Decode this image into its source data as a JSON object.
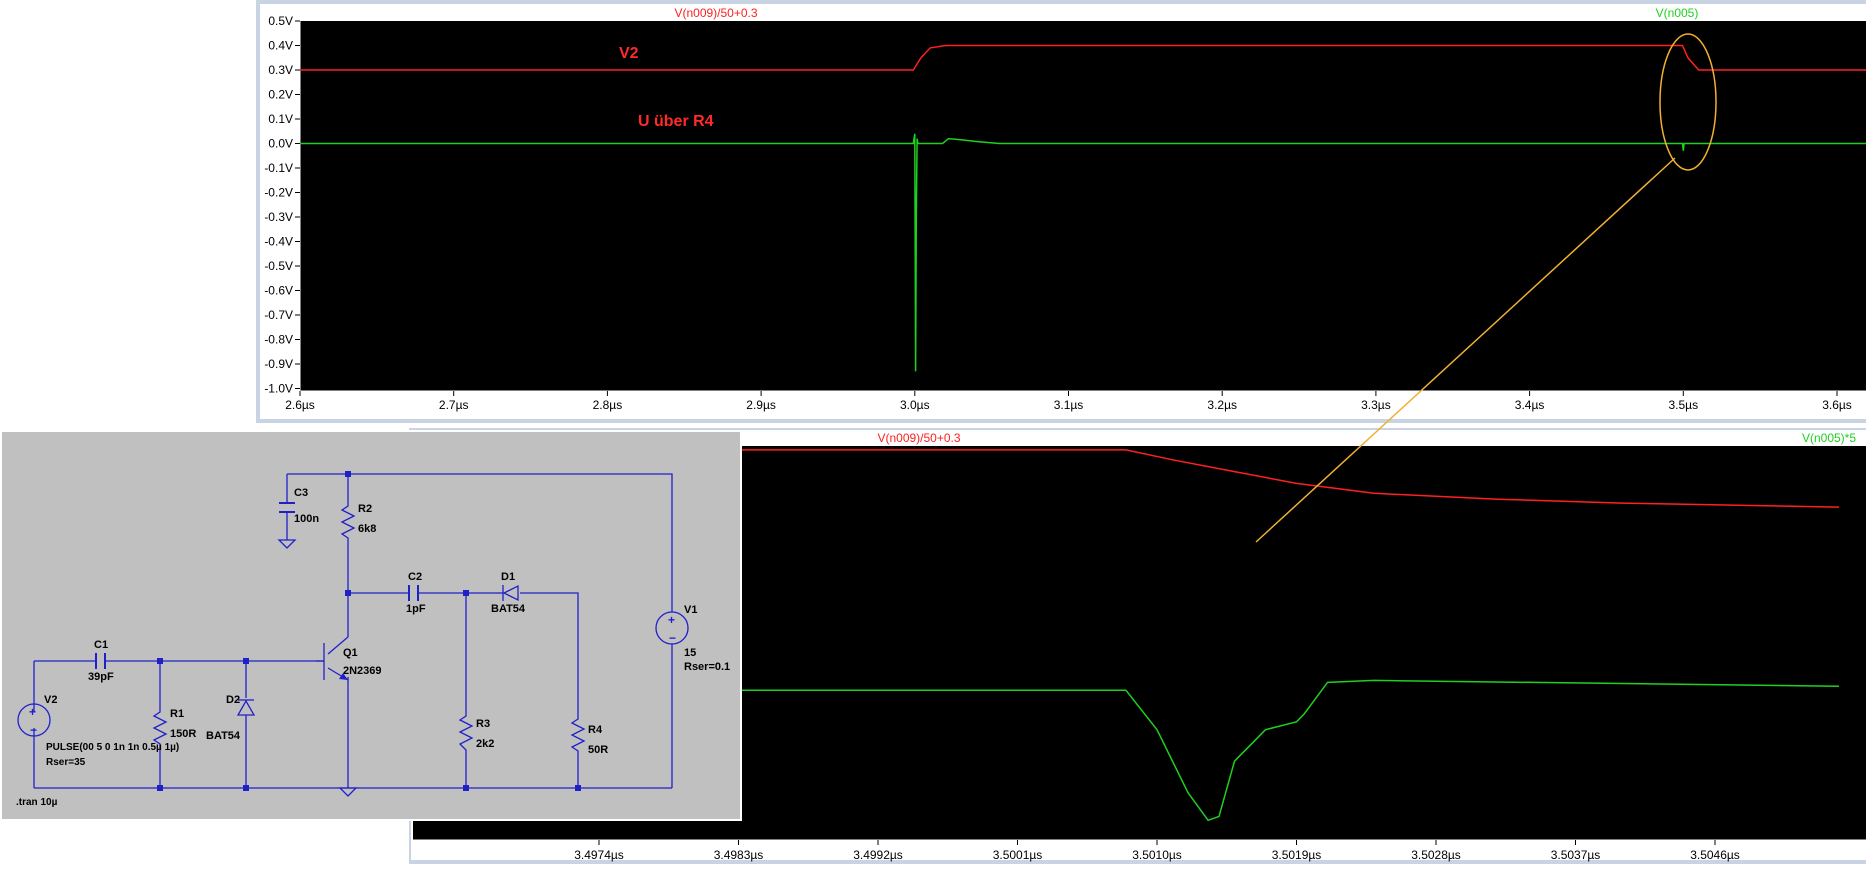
{
  "colors": {
    "trace_red": "#ff2020",
    "trace_green": "#1fd01f",
    "annotation": "#f0b030",
    "label_red": "#ff2a2a",
    "schematic_wire": "#2020c8",
    "schematic_bg": "#c0c0c0",
    "plot_bg": "#000000",
    "frame": "#c8d4e4"
  },
  "chart_data": [
    {
      "type": "line",
      "series": [
        {
          "name": "V(n009)/50+0.3",
          "color": "#ff2020",
          "x": [
            2.6,
            2.999,
            3.004,
            3.01,
            3.02,
            3.4995,
            3.503,
            3.51,
            3.62
          ],
          "y": [
            0.3,
            0.3,
            0.35,
            0.39,
            0.4,
            0.4,
            0.35,
            0.3,
            0.3
          ]
        },
        {
          "name": "V(n005)",
          "color": "#1fd01f",
          "x": [
            2.6,
            2.999,
            3.0,
            3.0005,
            3.001,
            3.0015,
            3.002,
            3.005,
            3.018,
            3.022,
            3.03,
            3.04,
            3.055,
            3.2,
            3.4995,
            3.5,
            3.5005,
            3.501,
            3.62
          ],
          "y": [
            0.0,
            0.0,
            0.04,
            -0.93,
            -0.3,
            0.02,
            0.0,
            0.0,
            0.0,
            0.02,
            0.015,
            0.008,
            0.0,
            0.0,
            0.0,
            -0.03,
            0.0,
            0.0,
            0.0
          ]
        }
      ],
      "xlabel": "",
      "ylabel": "",
      "xlim": [
        2.6,
        3.62
      ],
      "ylim": [
        -1.0,
        0.5
      ],
      "xticks": [
        2.6,
        2.7,
        2.8,
        2.9,
        3.0,
        3.1,
        3.2,
        3.3,
        3.4,
        3.5,
        3.6
      ],
      "xtick_labels": [
        "2.6µs",
        "2.7µs",
        "2.8µs",
        "2.9µs",
        "3.0µs",
        "3.1µs",
        "3.2µs",
        "3.3µs",
        "3.4µs",
        "3.5µs",
        "3.6µs"
      ],
      "yticks": [
        0.5,
        0.4,
        0.3,
        0.2,
        0.1,
        0.0,
        -0.1,
        -0.2,
        -0.3,
        -0.4,
        -0.5,
        -0.6,
        -0.7,
        -0.8,
        -0.9,
        -1.0
      ],
      "ytick_labels": [
        "0.5V",
        "0.4V",
        "0.3V",
        "0.2V",
        "0.1V",
        "0.0V",
        "-0.1V",
        "-0.2V",
        "-0.3V",
        "-0.4V",
        "-0.5V",
        "-0.6V",
        "-0.7V",
        "-0.8V",
        "-0.9V",
        "-1.0V"
      ],
      "annotations": [
        "V2",
        "U über R4"
      ],
      "grid": false
    },
    {
      "type": "line",
      "series": [
        {
          "name": "V(n009)/50+0.3",
          "color": "#ff2020",
          "x": [
            3.4962,
            3.5008,
            3.5011,
            3.5015,
            3.5019,
            3.5024,
            3.5032,
            3.504,
            3.5054
          ],
          "y": [
            0.99,
            0.99,
            0.965,
            0.935,
            0.905,
            0.88,
            0.865,
            0.855,
            0.845
          ]
        },
        {
          "name": "V(n005)*5",
          "color": "#1fd01f",
          "x": [
            3.4962,
            3.5008,
            3.501,
            3.5012,
            3.50133,
            3.5014,
            3.5015,
            3.5017,
            3.5019,
            3.50195,
            3.5021,
            3.5024,
            3.5054
          ],
          "y": [
            0.38,
            0.38,
            0.28,
            0.12,
            0.05,
            0.06,
            0.2,
            0.28,
            0.3,
            0.32,
            0.4,
            0.405,
            0.39
          ]
        }
      ],
      "xlabel": "",
      "ylabel": "",
      "xlim": [
        3.4962,
        3.5054
      ],
      "xticks": [
        3.4974,
        3.4983,
        3.4992,
        3.5001,
        3.501,
        3.5019,
        3.5028,
        3.5037,
        3.5046
      ],
      "xtick_labels": [
        "3.4974µs",
        "3.4983µs",
        "3.4992µs",
        "3.5001µs",
        "3.5010µs",
        "3.5019µs",
        "3.5028µs",
        "3.5037µs",
        "3.5046µs"
      ],
      "grid": false
    }
  ],
  "schematic": {
    "C3": {
      "name": "C3",
      "value": "100n"
    },
    "R2": {
      "name": "R2",
      "value": "6k8"
    },
    "C2": {
      "name": "C2",
      "value": "1pF"
    },
    "D1": {
      "name": "D1",
      "value": "BAT54"
    },
    "V1": {
      "name": "V1",
      "value": "15",
      "extra": "Rser=0.1"
    },
    "C1": {
      "name": "C1",
      "value": "39pF"
    },
    "Q1": {
      "name": "Q1",
      "value": "2N2369"
    },
    "V2": {
      "name": "V2",
      "value": "PULSE(00 5 0 1n 1n 0.5µ 1µ)",
      "extra": "Rser=35"
    },
    "R1": {
      "name": "R1",
      "value": "150R"
    },
    "D2": {
      "name": "D2",
      "value": "BAT54"
    },
    "R3": {
      "name": "R3",
      "value": "2k2"
    },
    "R4": {
      "name": "R4",
      "value": "50R"
    },
    "directive": ".tran 10µ"
  }
}
